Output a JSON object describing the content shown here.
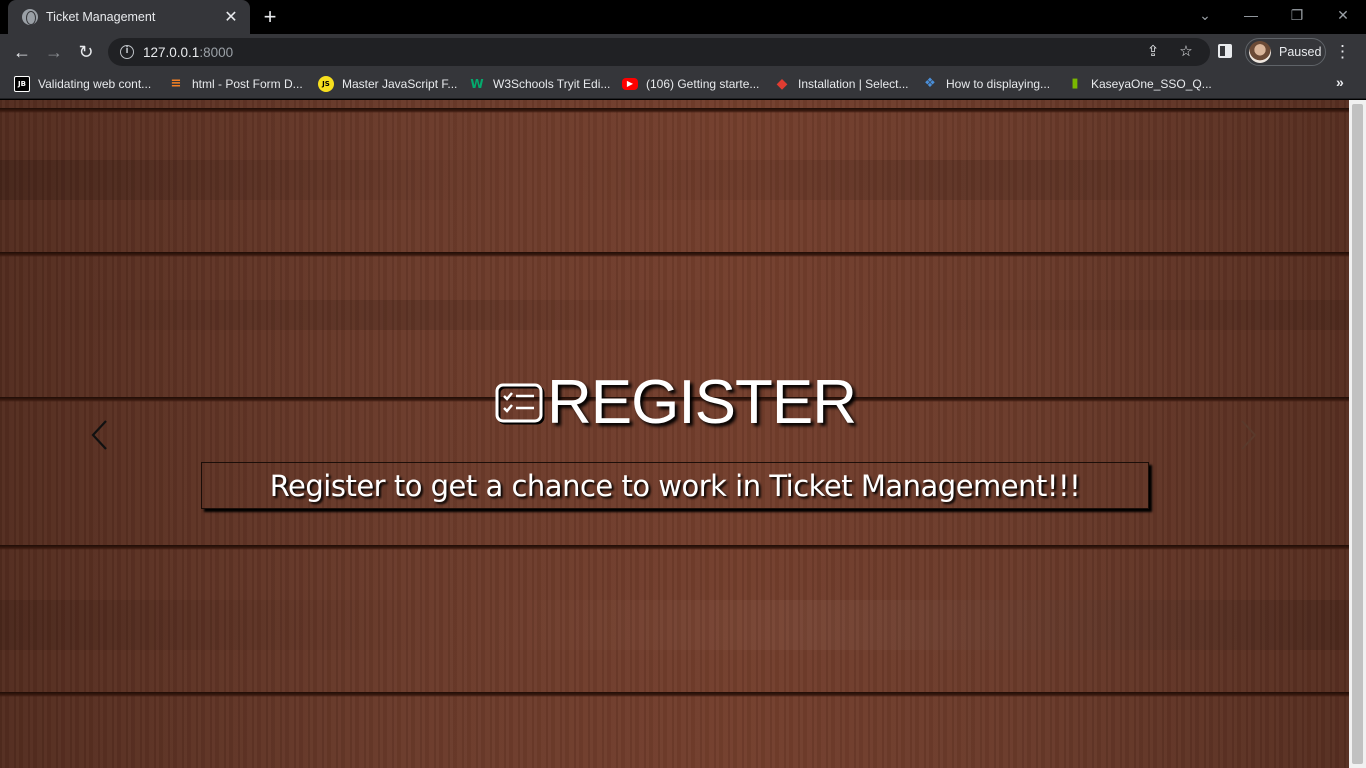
{
  "browser": {
    "tab": {
      "title": "Ticket Management",
      "close_glyph": "✕",
      "favicon": "globe-icon"
    },
    "new_tab_glyph": "+",
    "window_controls": {
      "tabsearch": "⌄",
      "minimize": "—",
      "restore": "❐",
      "close": "✕"
    },
    "nav": {
      "back": "←",
      "forward": "→",
      "reload": "↻"
    },
    "address": {
      "host": "127.0.0.1",
      "port": ":8000"
    },
    "profile": {
      "status": "Paused"
    },
    "menu_glyph": "⋮",
    "bookmarks": [
      {
        "label": "Validating web cont...",
        "icon": "jetbrains-icon",
        "icon_text": "JB",
        "color": "#000000",
        "fg": "#ffffff"
      },
      {
        "label": "html - Post Form D...",
        "icon": "stackoverflow-icon",
        "icon_text": "≡",
        "color": "#f48024",
        "fg": "#ffffff"
      },
      {
        "label": "Master JavaScript F...",
        "icon": "js-icon",
        "icon_text": "JS",
        "color": "#f7df1e",
        "fg": "#000000"
      },
      {
        "label": "W3Schools Tryit Edi...",
        "icon": "w3schools-icon",
        "icon_text": "W",
        "color": "#04aa6d",
        "fg": "#ffffff"
      },
      {
        "label": "(106) Getting starte...",
        "icon": "youtube-icon",
        "icon_text": "▶",
        "color": "#ff0000",
        "fg": "#ffffff"
      },
      {
        "label": "Installation | Select...",
        "icon": "select2-icon",
        "icon_text": "◆",
        "color": "#2d6fd6",
        "fg": "#e03c31"
      },
      {
        "label": "How to displaying...",
        "icon": "forum-icon",
        "icon_text": "❖",
        "color": "#4a8fd9",
        "fg": "#ffffff"
      },
      {
        "label": "KaseyaOne_SSO_Q...",
        "icon": "kaseya-icon",
        "icon_text": "▮",
        "color": "#7ab800",
        "fg": "#1e3d00"
      }
    ],
    "bookmarks_overflow": "»"
  },
  "page": {
    "title": "REGISTER",
    "title_icon": "checklist-card-icon",
    "subtitle": "Register to get a chance to work in Ticket Management!!!",
    "prev_icon": "chevron-left-icon",
    "next_icon": "chevron-right-icon"
  }
}
